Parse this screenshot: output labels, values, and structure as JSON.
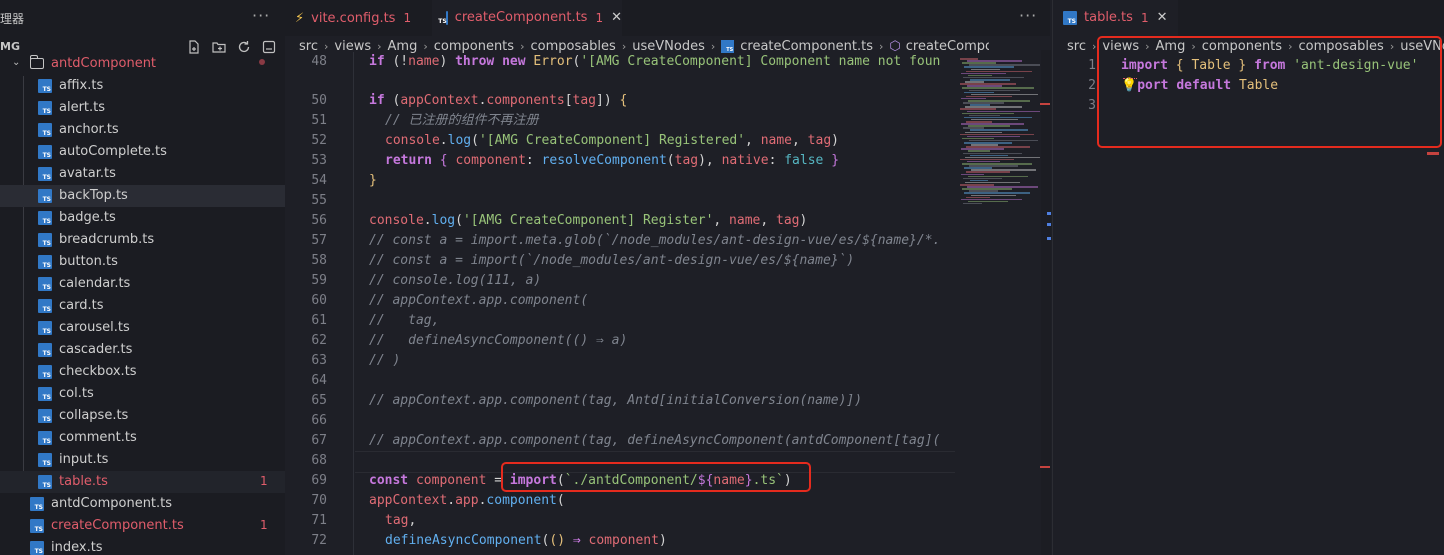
{
  "explorer": {
    "title": "理器",
    "more": "···",
    "project": "MG",
    "folder": "antdComponent",
    "files": [
      {
        "name": "affix.ts"
      },
      {
        "name": "alert.ts"
      },
      {
        "name": "anchor.ts"
      },
      {
        "name": "autoComplete.ts"
      },
      {
        "name": "avatar.ts"
      },
      {
        "name": "backTop.ts"
      },
      {
        "name": "badge.ts"
      },
      {
        "name": "breadcrumb.ts"
      },
      {
        "name": "button.ts"
      },
      {
        "name": "calendar.ts"
      },
      {
        "name": "card.ts"
      },
      {
        "name": "carousel.ts"
      },
      {
        "name": "cascader.ts"
      },
      {
        "name": "checkbox.ts"
      },
      {
        "name": "col.ts"
      },
      {
        "name": "collapse.ts"
      },
      {
        "name": "comment.ts"
      },
      {
        "name": "input.ts"
      },
      {
        "name": "table.ts",
        "badge": "1"
      }
    ],
    "root_files": [
      {
        "name": "antdComponent.ts"
      },
      {
        "name": "createComponent.ts",
        "badge": "1"
      },
      {
        "name": "index.ts"
      }
    ],
    "ts_badge": "TS"
  },
  "editor1": {
    "tabs": [
      {
        "label": "vite.config.ts",
        "count": "1",
        "icon": "vite-icon"
      },
      {
        "label": "createComponent.ts",
        "count": "1",
        "close": "✕"
      }
    ],
    "more": "···",
    "breadcrumb": [
      "src",
      "views",
      "Amg",
      "components",
      "composables",
      "useVNodes",
      "createComponent.ts",
      "createComponent"
    ],
    "line_numbers": [
      "48",
      "50",
      "51",
      "52",
      "53",
      "54",
      "55",
      "56",
      "57",
      "58",
      "59",
      "60",
      "61",
      "62",
      "63",
      "64",
      "65",
      "66",
      "67",
      "68",
      "69",
      "70",
      "71",
      "72"
    ]
  },
  "editor2": {
    "tab": {
      "label": "table.ts",
      "count": "1",
      "close": "✕"
    },
    "breadcrumb": [
      "src",
      "views",
      "Amg",
      "components",
      "composables",
      "useVNode"
    ],
    "line_numbers": [
      "1",
      "2",
      "3"
    ]
  },
  "colors": {
    "accent_error": "#e05d6b",
    "highlight_box": "#e52b1e",
    "ts_blue": "#3178c6"
  }
}
